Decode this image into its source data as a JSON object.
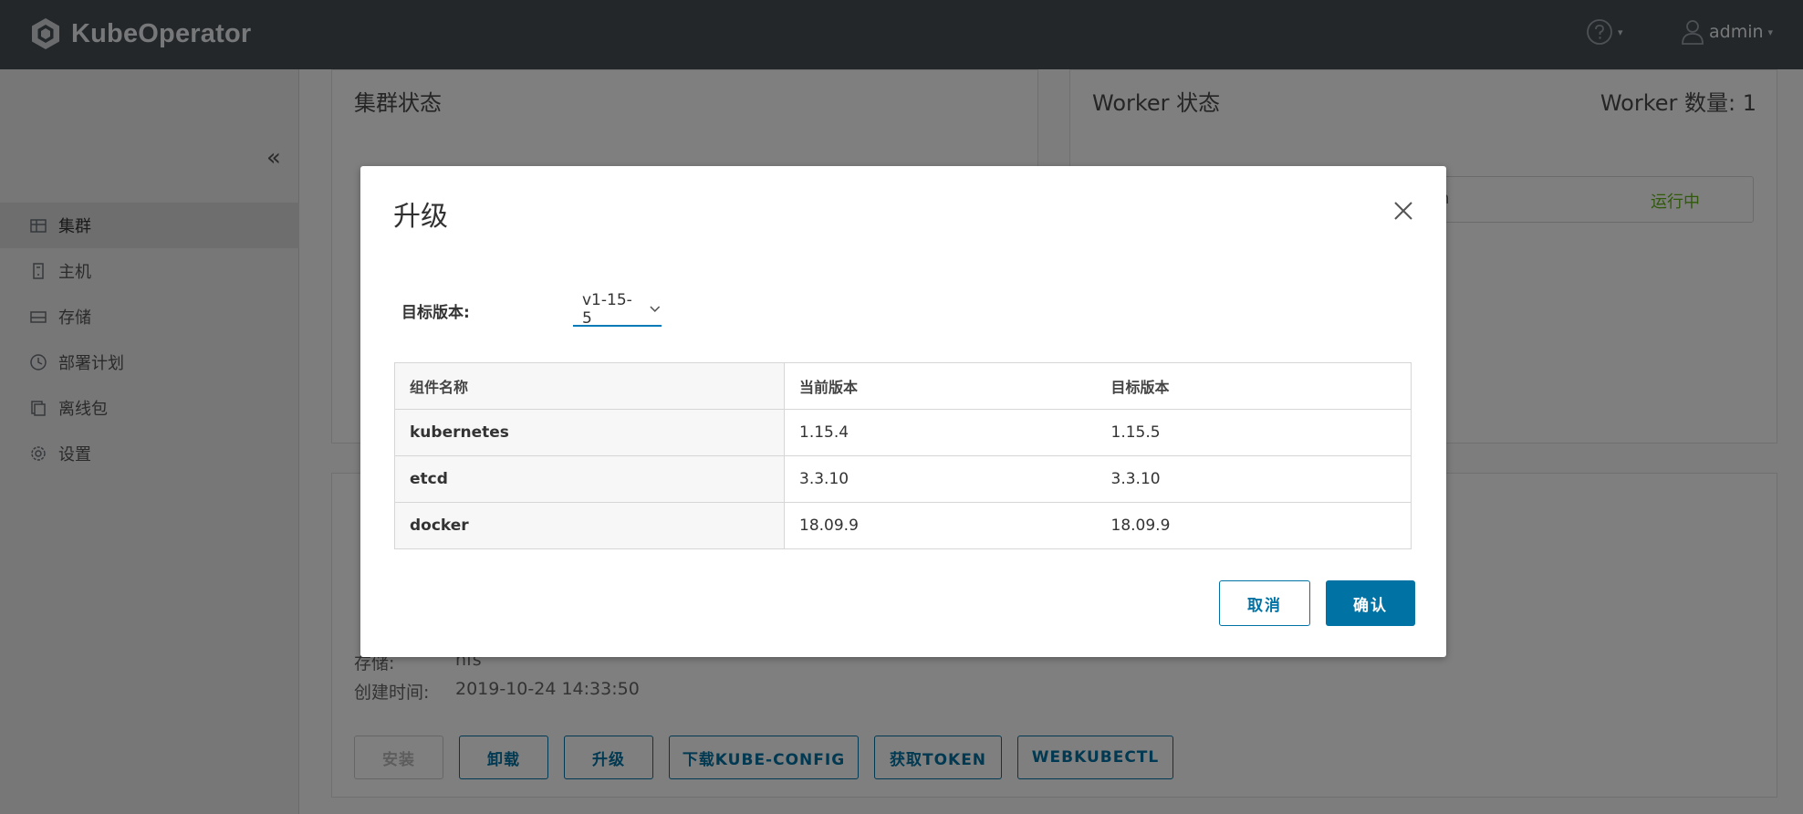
{
  "app": {
    "brand": "KubeOperator"
  },
  "header": {
    "user": "admin"
  },
  "sidebar": {
    "items": [
      {
        "label": "集群",
        "icon": "cluster-icon",
        "active": true
      },
      {
        "label": "主机",
        "icon": "host-icon",
        "active": false
      },
      {
        "label": "存储",
        "icon": "storage-icon",
        "active": false
      },
      {
        "label": "部署计划",
        "icon": "clock-icon",
        "active": false
      },
      {
        "label": "离线包",
        "icon": "package-icon",
        "active": false
      },
      {
        "label": "设置",
        "icon": "gear-icon",
        "active": false
      }
    ]
  },
  "main": {
    "cluster_status_title": "集群状态",
    "worker_status_title": "Worker 状态",
    "worker_count": "Worker 数量: 1",
    "worker_status_fragment": "m",
    "worker_running": "运行中",
    "info": {
      "storage_label": "存储:",
      "storage_value": "nfs",
      "created_label": "创建时间:",
      "created_value": "2019-10-24 14:33:50"
    },
    "actions": {
      "install": "安装",
      "uninstall": "卸载",
      "upgrade": "升级",
      "download_kubeconfig": "下载KUBE-CONFIG",
      "get_token": "获取TOKEN",
      "webkubectl": "WEBKUBECTL"
    }
  },
  "modal": {
    "title": "升级",
    "target_version_label": "目标版本:",
    "target_version_value": "v1-15-5",
    "table": {
      "headers": [
        "组件名称",
        "当前版本",
        "目标版本"
      ],
      "rows": [
        [
          "kubernetes",
          "1.15.4",
          "1.15.5"
        ],
        [
          "etcd",
          "3.3.10",
          "3.3.10"
        ],
        [
          "docker",
          "18.09.9",
          "18.09.9"
        ]
      ]
    },
    "cancel_label": "取消",
    "confirm_label": "确认"
  },
  "colors": {
    "header_bg": "#474e55",
    "primary": "#0072a3",
    "select_underline": "#0079b8",
    "running_green": "#60b515"
  }
}
